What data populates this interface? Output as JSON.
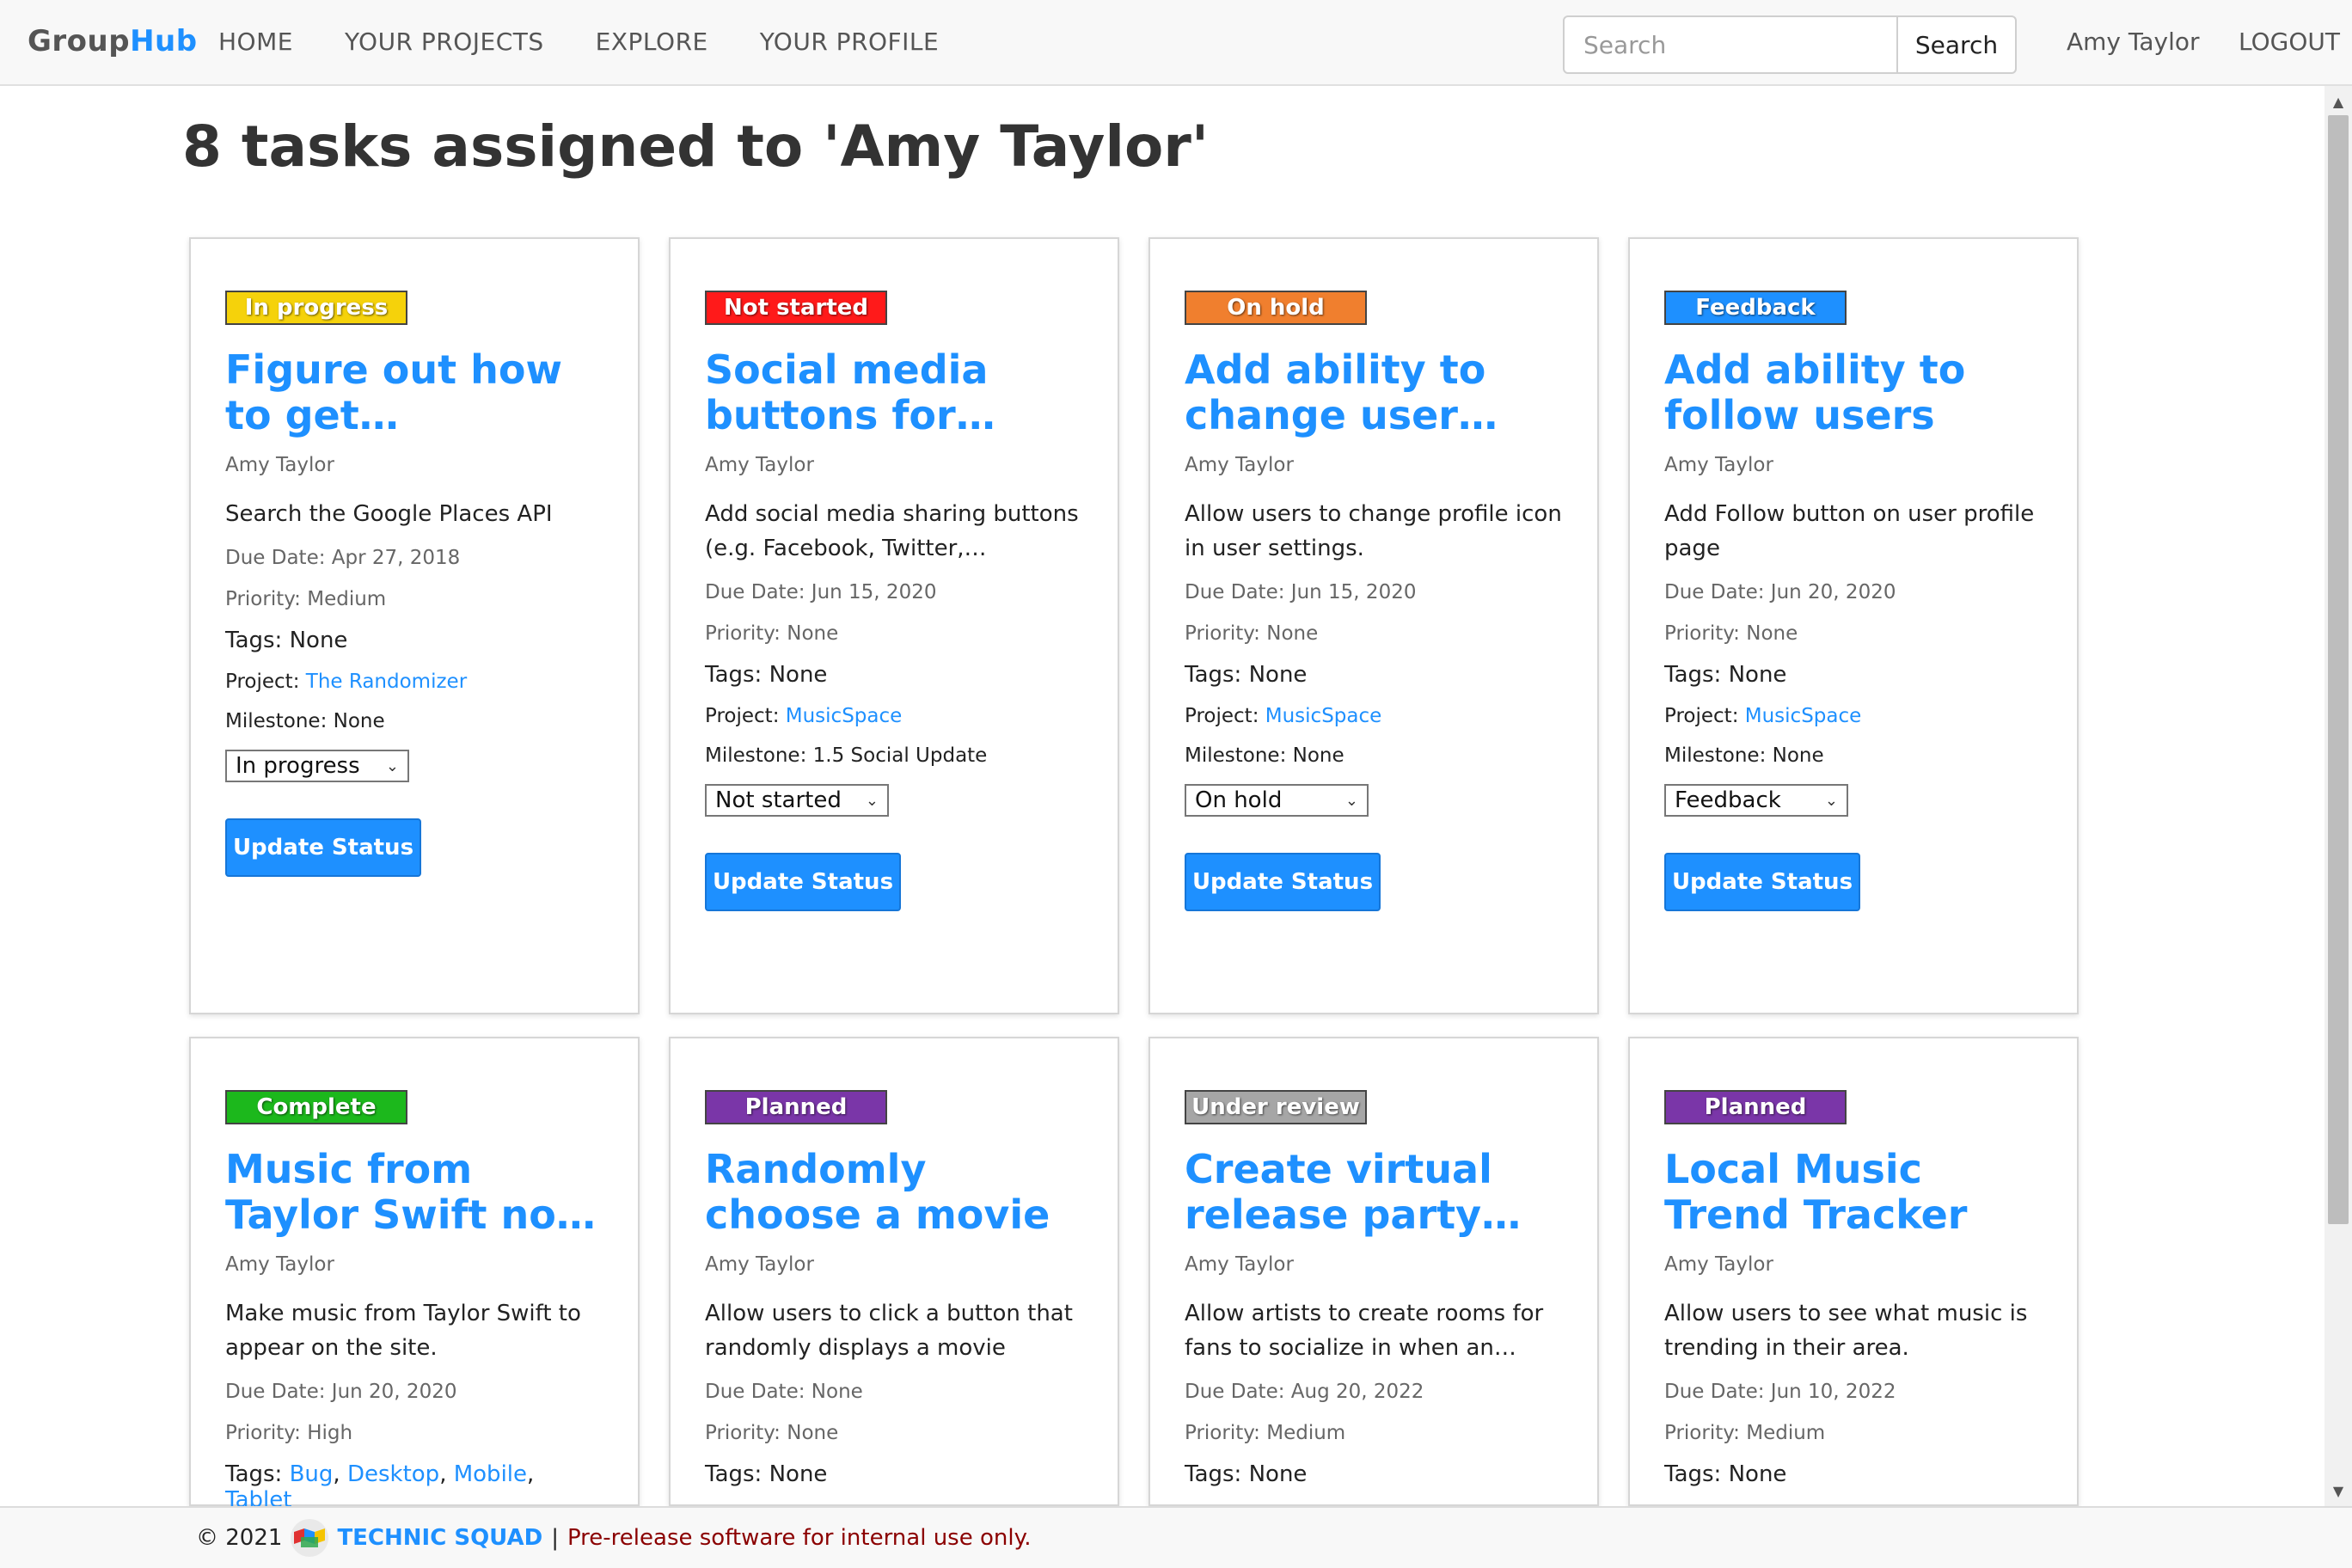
{
  "navbar": {
    "brand_part1": "Group",
    "brand_part2": "Hub",
    "links": [
      "HOME",
      "YOUR PROJECTS",
      "EXPLORE",
      "YOUR PROFILE"
    ],
    "search_placeholder": "Search",
    "search_button": "Search",
    "user_name": "Amy Taylor",
    "logout": "LOGOUT"
  },
  "page_title": "8 tasks assigned to 'Amy Taylor'",
  "labels": {
    "due_prefix": "Due Date: ",
    "priority_prefix": "Priority: ",
    "tags_prefix": "Tags: ",
    "project_prefix": "Project: ",
    "milestone_prefix": "Milestone: ",
    "update_button": "Update Status"
  },
  "tasks": [
    {
      "status": "In progress",
      "status_color": "#f5d20b",
      "title": "Figure out how to get entertainment recommendations",
      "assignee": "Amy Taylor",
      "description": "Search the Google Places API",
      "due_date": "Apr 27, 2018",
      "priority": "Medium",
      "tags": "None",
      "project": "The Randomizer",
      "milestone": "None",
      "select_value": "In progress"
    },
    {
      "status": "Not started",
      "status_color": "#ff1a1a",
      "title": "Social media buttons for sharing",
      "assignee": "Amy Taylor",
      "description": "Add social media sharing buttons (e.g. Facebook, Twitter, Instagram...",
      "due_date": "Jun 15, 2020",
      "priority": "None",
      "tags": "None",
      "project": "MusicSpace",
      "milestone": "1.5 Social Update",
      "select_value": "Not started"
    },
    {
      "status": "On hold",
      "status_color": "#f07f2e",
      "title": "Add ability to change user profile icon",
      "assignee": "Amy Taylor",
      "description": "Allow users to change profile icon in user settings.",
      "due_date": "Jun 15, 2020",
      "priority": "None",
      "tags": "None",
      "project": "MusicSpace",
      "milestone": "None",
      "select_value": "On hold"
    },
    {
      "status": "Feedback",
      "status_color": "#1e90ff",
      "title": "Add ability to follow users",
      "assignee": "Amy Taylor",
      "description": "Add Follow button on user profile page",
      "due_date": "Jun 20, 2020",
      "priority": "None",
      "tags": "None",
      "project": "MusicSpace",
      "milestone": "None",
      "select_value": "Feedback"
    },
    {
      "status": "Complete",
      "status_color": "#1cb81c",
      "title": "Music from Taylor Swift not appearing",
      "assignee": "Amy Taylor",
      "description": "Make music from Taylor Swift to appear on the site.",
      "due_date": "Jun 20, 2020",
      "priority": "High",
      "tags_list": [
        "Bug",
        "Desktop",
        "Mobile",
        "Tablet"
      ]
    },
    {
      "status": "Planned",
      "status_color": "#7a36a8",
      "title": "Randomly choose a movie",
      "assignee": "Amy Taylor",
      "description": "Allow users to click a button that randomly displays a movie",
      "due_date": "None",
      "priority": "None",
      "tags": "None"
    },
    {
      "status": "Under review",
      "status_color": "#a6a6a6",
      "title": "Create virtual release party rooms",
      "assignee": "Amy Taylor",
      "description": "Allow artists to create rooms for fans to socialize in when an album...",
      "due_date": "Aug 20, 2022",
      "priority": "Medium",
      "tags": "None"
    },
    {
      "status": "Planned",
      "status_color": "#7a36a8",
      "title": "Local Music Trend Tracker",
      "assignee": "Amy Taylor",
      "description": "Allow users to see what music is trending in their area.",
      "due_date": "Jun 10, 2022",
      "priority": "Medium",
      "tags": "None"
    }
  ],
  "footer": {
    "copyright": "© 2021",
    "company": "TECHNIC SQUAD",
    "separator": "|",
    "notice": "Pre-release software for internal use only."
  },
  "icons": {
    "dropdown": "chevron-down-icon",
    "logo": "technic-squad-logo",
    "scroll_up": "arrow-up-icon",
    "scroll_down": "arrow-down-icon"
  }
}
